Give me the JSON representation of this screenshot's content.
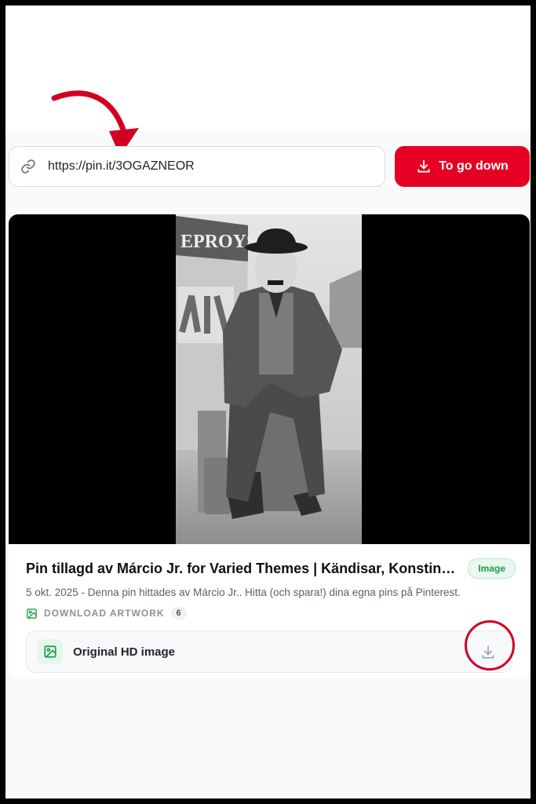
{
  "url_field": {
    "value": "https://pin.it/3OGAZNEOR",
    "icon": "link-icon"
  },
  "download_button": {
    "label": "To go down",
    "icon": "download-icon",
    "color": "#e60023"
  },
  "result": {
    "title": "Pin tillagd av Márcio Jr. for Varied Themes | Kändisar, Konstinspi...",
    "type_badge": "Image",
    "description": "5 okt. 2025 - Denna pin hittades av Márcio Jr.. Hitta (och spara!) dina egna pins på Pinterest.",
    "section_label": "DOWNLOAD ARTWORK",
    "section_count": "6",
    "options": [
      {
        "label": "Original HD image",
        "icon": "image-icon"
      }
    ]
  },
  "annotations": {
    "arrow_color": "#d10023",
    "circle_color": "#d10023"
  },
  "colors": {
    "accent_green": "#1e9b4d",
    "accent_red": "#e60023"
  }
}
